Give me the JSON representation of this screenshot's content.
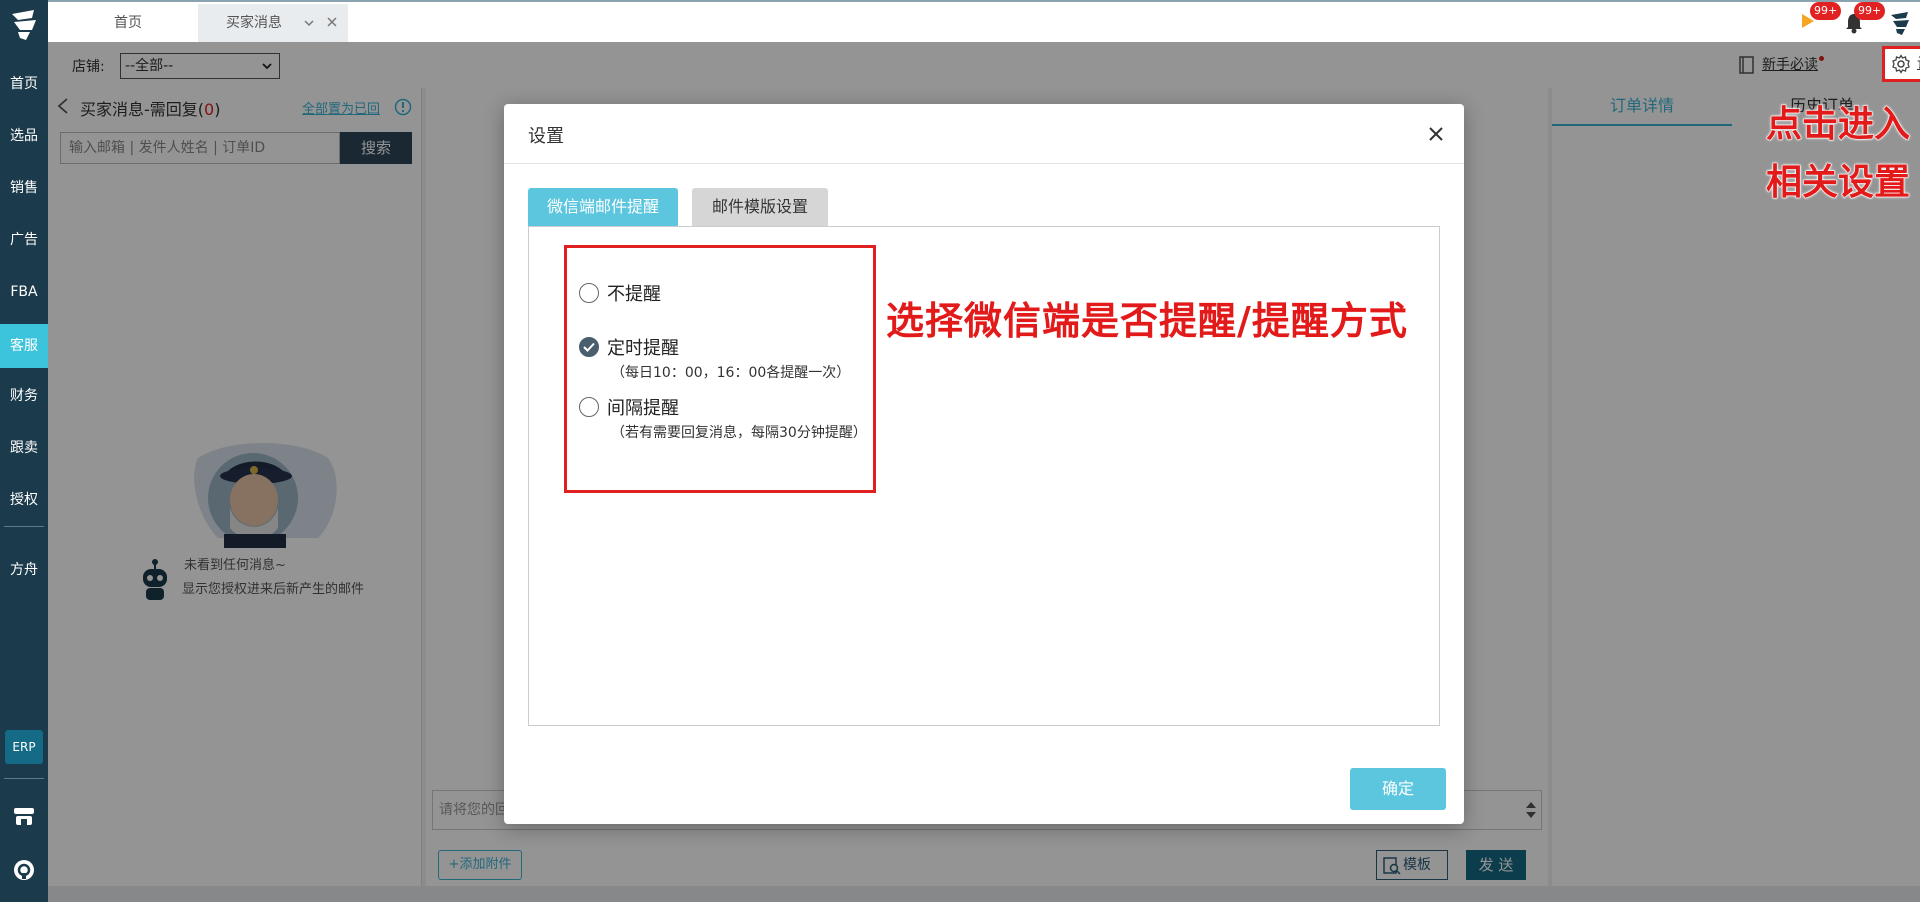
{
  "sidebar": {
    "items": [
      {
        "label": "首页"
      },
      {
        "label": "选品"
      },
      {
        "label": "销售"
      },
      {
        "label": "广告"
      },
      {
        "label": "FBA"
      },
      {
        "label": "客服",
        "active": true
      },
      {
        "label": "财务"
      },
      {
        "label": "跟卖"
      },
      {
        "label": "授权"
      },
      {
        "label": "方舟"
      }
    ],
    "erp_label": "ERP",
    "active_color": "#3cc4dc",
    "bg_color": "#1b3a4b"
  },
  "tabs": {
    "home": "首页",
    "buyer": "买家消息"
  },
  "badges": {
    "flag": "99+",
    "bell": "99+"
  },
  "storebar": {
    "label": "店铺:",
    "selected": "--全部--",
    "guide": "新手必读",
    "settings": "设置"
  },
  "listpanel": {
    "title": "买家消息-需回复",
    "count": "0",
    "read_all": "全部置为已回",
    "search_placeholder": "输入邮箱 | 发件人姓名 | 订单ID",
    "search_button": "搜索",
    "empty_line1": "未看到任何消息~",
    "empty_line2": "显示您授权进来后新产生的邮件"
  },
  "midpanel": {
    "input_placeholder": "请将您的回",
    "attach": "+添加附件",
    "template": "模板",
    "send": "发 送"
  },
  "rightpanel": {
    "tab1": "订单详情",
    "tab2": "历史订单"
  },
  "modal": {
    "title": "设置",
    "tab_active": "微信端邮件提醒",
    "tab_inactive": "邮件模版设置",
    "options": [
      {
        "label": "不提醒",
        "sub": "",
        "checked": false
      },
      {
        "label": "定时提醒",
        "sub": "（每日10：00，16：00各提醒一次）",
        "checked": true
      },
      {
        "label": "间隔提醒",
        "sub": "（若有需要回复消息，每隔30分钟提醒）",
        "checked": false
      }
    ],
    "confirm": "确定",
    "accent_color": "#5bc6de"
  },
  "annotations": {
    "right_line1": "点击进入",
    "right_line2": "相关设置",
    "middle": "选择微信端是否提醒/提醒方式",
    "color": "#e21a1a"
  }
}
